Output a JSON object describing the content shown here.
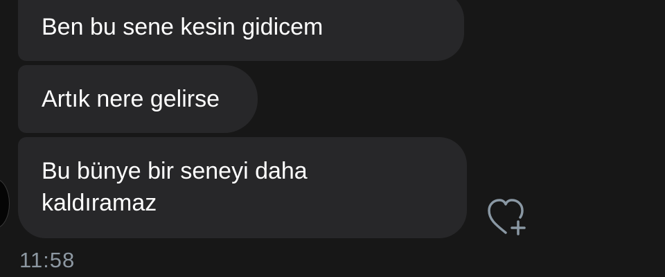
{
  "messages": [
    {
      "text": "Ben bu sene kesin gidicem"
    },
    {
      "text": "Artık nere gelirse"
    },
    {
      "text": "Bu bünye bir seneyi daha kaldıramaz"
    }
  ],
  "timestamp": "11:58",
  "react_icon": "heart-plus-icon",
  "colors": {
    "background": "#171717",
    "bubble": "#272729",
    "text": "#ffffff",
    "timestamp": "#8d98a2",
    "icon": "#8a98a4"
  }
}
